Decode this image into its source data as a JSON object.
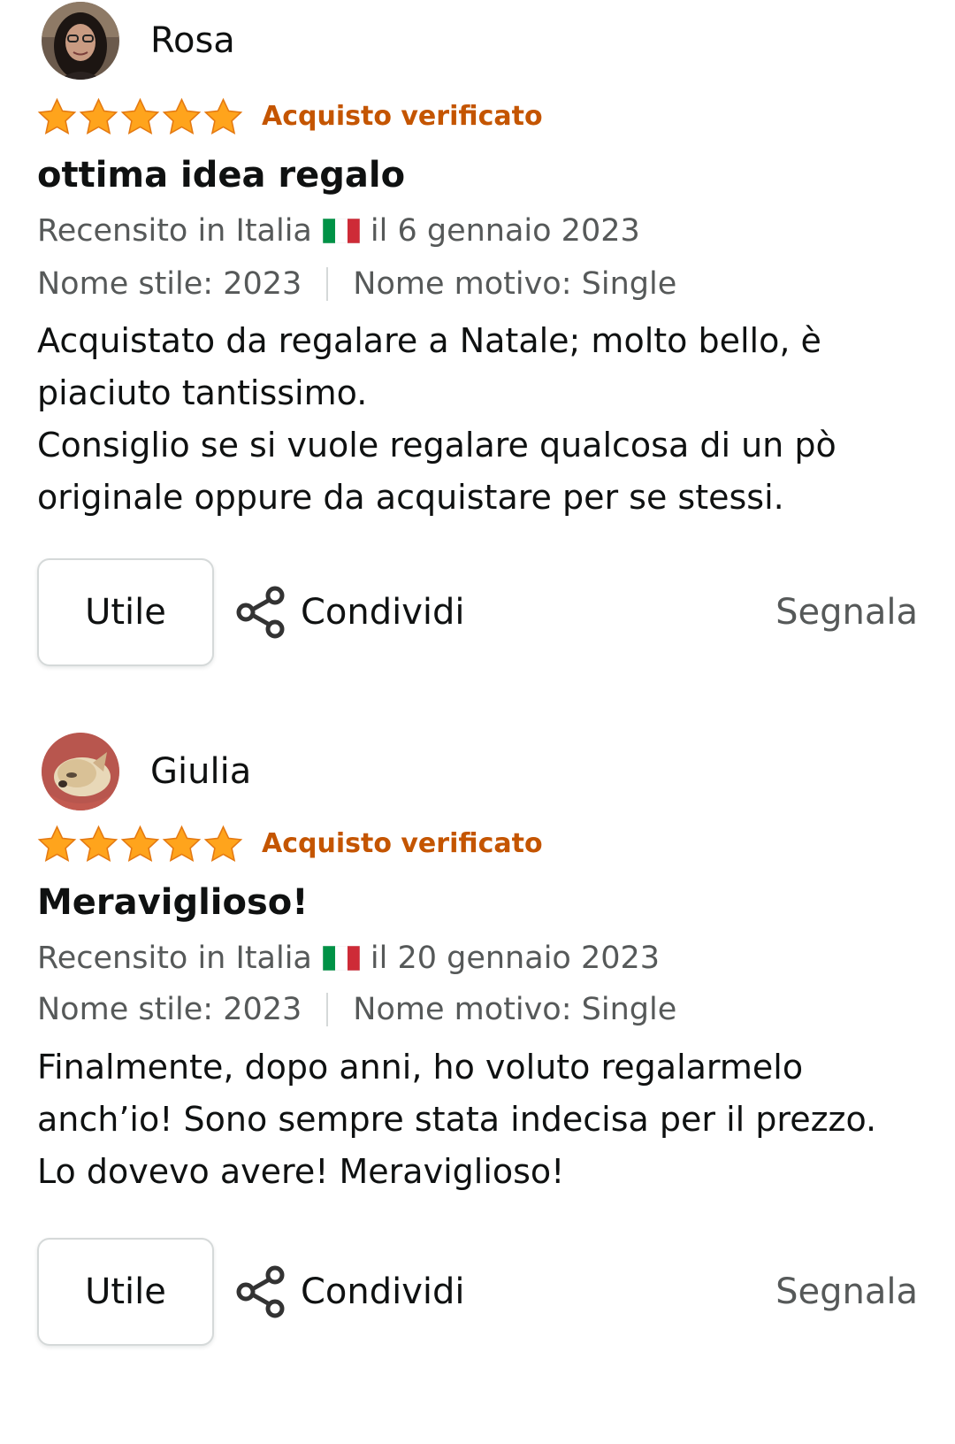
{
  "colors": {
    "star": "#ffa41c",
    "verified": "#c45500",
    "meta_text": "#565959"
  },
  "reviews": [
    {
      "reviewer": "Rosa",
      "rating": 5,
      "verified_label": "Acquisto verificato",
      "title": "ottima idea regalo",
      "date_prefix": "Recensito in Italia",
      "date_suffix": "il 6 gennaio 2023",
      "style_label": "Nome stile: 2023",
      "pattern_label": "Nome motivo: Single",
      "body": [
        "Acquistato da regalare a Natale; molto bello, è piaciuto tantissimo.",
        "Consiglio se si vuole regalare qualcosa di un pò originale oppure da acquistare per se stessi."
      ],
      "useful_label": "Utile",
      "share_label": "Condividi",
      "report_label": "Segnala"
    },
    {
      "reviewer": "Giulia",
      "rating": 5,
      "verified_label": "Acquisto verificato",
      "title": "Meraviglioso!",
      "date_prefix": "Recensito in Italia",
      "date_suffix": "il 20 gennaio 2023",
      "style_label": "Nome stile: 2023",
      "pattern_label": "Nome motivo: Single",
      "body": [
        "Finalmente, dopo anni, ho voluto regalarmelo anch’io! Sono sempre stata indecisa per il prezzo. Lo dovevo avere! Meraviglioso!"
      ],
      "useful_label": "Utile",
      "share_label": "Condividi",
      "report_label": "Segnala"
    }
  ]
}
